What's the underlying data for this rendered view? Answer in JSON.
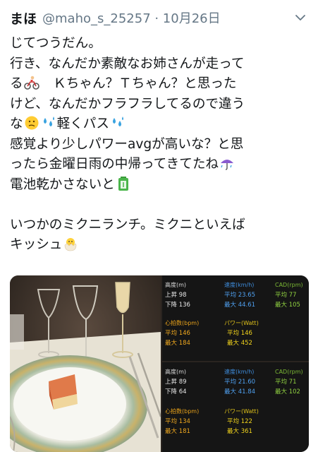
{
  "tweet": {
    "display_name": "まほ",
    "handle_date": "@maho_s_25257 · 10月26日",
    "lines": [
      {
        "text": "じてつうだん。"
      },
      {
        "text": "行き、なんだか素敵なお姉さんが走って"
      },
      {
        "pre": "る",
        "emoji": "cyclist",
        "post": "　Ｋちゃん？Ｔちゃん？と思った"
      },
      {
        "text": "けど、なんだかフラフラしてるので違う"
      },
      {
        "pre": "な",
        "emoji": "confused-face",
        "mid": "軽くパス",
        "emoji2": "sweat-droplets"
      },
      {
        "text": "感覚より少しパワーavgが高いな？と思"
      },
      {
        "pre": "ったら金曜日雨の中帰ってきてたね",
        "emoji": "umbrella-rain"
      },
      {
        "pre": "電池乾かさないと",
        "emoji": "battery"
      },
      {
        "text": ""
      },
      {
        "text": "いつかのミクニランチ。ミクニといえば"
      },
      {
        "pre": "キッシュ",
        "emoji": "chick"
      }
    ]
  },
  "emojis": {
    "cyclist": "bicyclist-icon",
    "confused-face": "confused-face-icon",
    "sweat-droplets": "sweat-droplets-icon",
    "umbrella-rain": "umbrella-rain-icon",
    "battery": "battery-icon",
    "chick": "hatching-chick-icon"
  },
  "ride_stats": [
    {
      "elev_label": "高度(m)",
      "climb_label": "上昇",
      "climb": "98",
      "descent_label": "下降",
      "descent": "136",
      "speed_label": "速度(km/h)",
      "speed_avg_label": "平均",
      "speed_avg": "23.65",
      "speed_max_label": "最大",
      "speed_max": "44.61",
      "cad_label": "CAD(rpm)",
      "cad_avg_label": "平均",
      "cad_avg": "77",
      "cad_max_label": "最大",
      "cad_max": "105",
      "hr_label": "心拍数(bpm)",
      "hr_avg_label": "平均",
      "hr_avg": "146",
      "hr_max_label": "最大",
      "hr_max": "184",
      "pwr_label": "パワー(Watt)",
      "pwr_avg_label": "平均",
      "pwr_avg": "146",
      "pwr_max_label": "最大",
      "pwr_max": "452"
    },
    {
      "elev_label": "高度(m)",
      "climb_label": "上昇",
      "climb": "89",
      "descent_label": "下降",
      "descent": "64",
      "speed_label": "速度(km/h)",
      "speed_avg_label": "平均",
      "speed_avg": "21.60",
      "speed_max_label": "最大",
      "speed_max": "41.84",
      "cad_label": "CAD(rpm)",
      "cad_avg_label": "平均",
      "cad_avg": "71",
      "cad_max_label": "最大",
      "cad_max": "102",
      "hr_label": "心拍数(bpm)",
      "hr_avg_label": "平均",
      "hr_avg": "134",
      "hr_max_label": "最大",
      "hr_max": "181",
      "pwr_label": "パワー(Watt)",
      "pwr_avg_label": "平均",
      "pwr_avg": "122",
      "pwr_max_label": "最大",
      "pwr_max": "361"
    }
  ]
}
